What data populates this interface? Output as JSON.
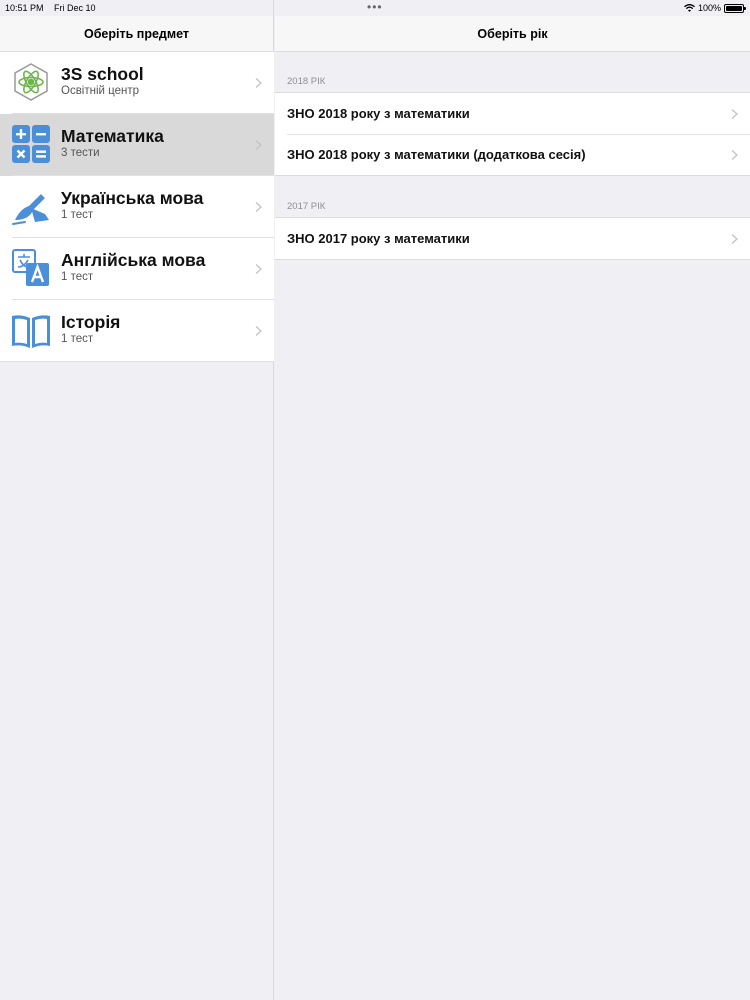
{
  "status_bar": {
    "time": "10:51 PM",
    "date": "Fri Dec 10",
    "battery": "100%",
    "battery_level": 1.0
  },
  "left_pane": {
    "title": "Оберіть предмет",
    "subjects": [
      {
        "title": "3S school",
        "subtitle": "Освітній центр",
        "icon": "atom-logo-icon",
        "selected": false
      },
      {
        "title": "Математика",
        "subtitle": "3 тести",
        "icon": "calculator-icon",
        "selected": true
      },
      {
        "title": "Українська мова",
        "subtitle": "1 тест",
        "icon": "writing-hand-icon",
        "selected": false
      },
      {
        "title": "Англійська мова",
        "subtitle": "1 тест",
        "icon": "translate-icon",
        "selected": false
      },
      {
        "title": "Історія",
        "subtitle": "1 тест",
        "icon": "open-book-icon",
        "selected": false
      }
    ]
  },
  "right_pane": {
    "title": "Оберіть рік",
    "sections": [
      {
        "header": "2018 РІК",
        "items": [
          "ЗНО 2018 року з математики",
          "ЗНО 2018 року з математики (додаткова сесія)"
        ]
      },
      {
        "header": "2017 РІК",
        "items": [
          "ЗНО 2017 року з математики"
        ]
      }
    ]
  },
  "colors": {
    "accent_blue": "#4a8fd8",
    "selected_row": "#d9d9d9",
    "background": "#efeff4"
  }
}
